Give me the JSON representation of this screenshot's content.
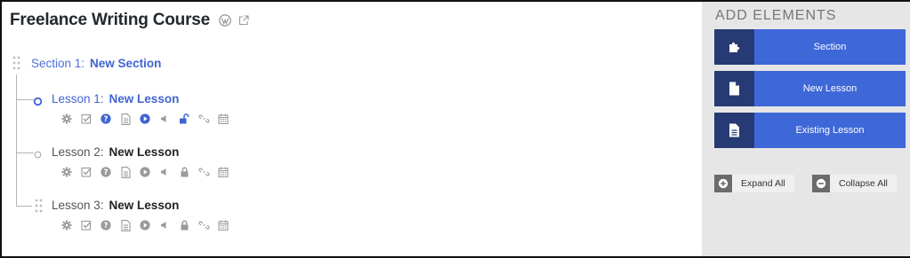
{
  "course": {
    "title": "Freelance Writing Course"
  },
  "section": {
    "number_label": "Section 1:",
    "name": "New Section"
  },
  "lessons": [
    {
      "number_label": "Lesson 1:",
      "name": "New Lesson"
    },
    {
      "number_label": "Lesson 2:",
      "name": "New Lesson"
    },
    {
      "number_label": "Lesson 3:",
      "name": "New Lesson"
    }
  ],
  "lesson_tool_icons": [
    "gear-icon",
    "checkbox-icon",
    "help-icon",
    "document-icon",
    "play-icon",
    "audio-icon",
    "lock-icon",
    "link-icon",
    "calendar-icon"
  ],
  "sidebar": {
    "title": "ADD ELEMENTS",
    "buttons": [
      {
        "label": "Section",
        "icon": "puzzle-icon"
      },
      {
        "label": "New Lesson",
        "icon": "document-icon"
      },
      {
        "label": "Existing Lesson",
        "icon": "document-lines-icon"
      }
    ],
    "expand_all": "Expand All",
    "collapse_all": "Collapse All"
  },
  "colors": {
    "accent": "#3e67d8",
    "accent_dark": "#263a73",
    "active_text": "#3f64d1",
    "icon_gray": "#9a9a9a",
    "sidebar_bg": "#e6e6e6"
  }
}
